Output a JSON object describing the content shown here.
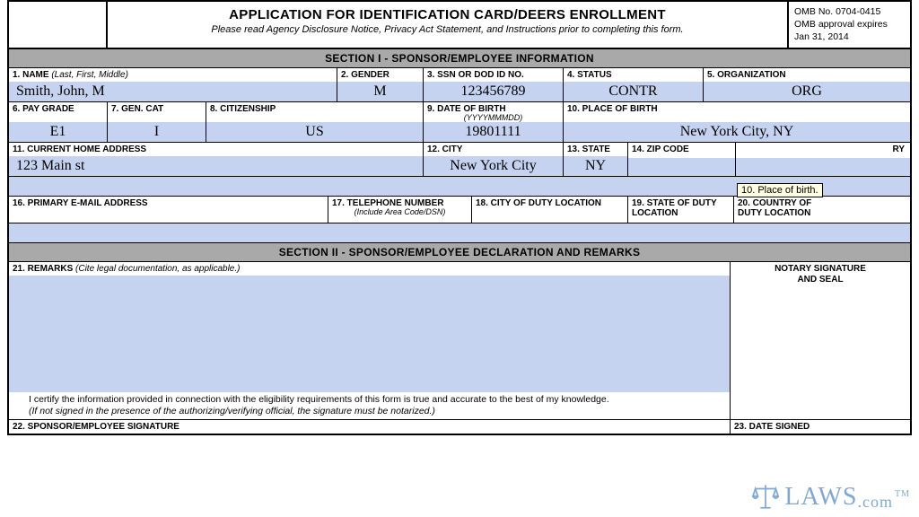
{
  "header": {
    "title": "APPLICATION FOR IDENTIFICATION CARD/DEERS ENROLLMENT",
    "subtitle": "Please read Agency Disclosure Notice, Privacy Act Statement, and Instructions prior to completing this form.",
    "omb_no": "OMB No. 0704-0415",
    "omb_exp": "OMB approval expires",
    "omb_date": "Jan 31, 2014"
  },
  "section1": {
    "title": "SECTION I - SPONSOR/EMPLOYEE INFORMATION",
    "f1": {
      "label": "1.  NAME",
      "paren": " (Last, First, Middle)",
      "value": "Smith, John, M"
    },
    "f2": {
      "label": "2.  GENDER",
      "value": "M"
    },
    "f3": {
      "label": "3.  SSN OR DOD ID NO.",
      "value": "123456789"
    },
    "f4": {
      "label": "4.  STATUS",
      "value": "CONTR"
    },
    "f5": {
      "label": "5.  ORGANIZATION",
      "value": "ORG"
    },
    "g6": {
      "label": "6.  PAY GRADE",
      "value": "E1"
    },
    "g7": {
      "label": "7.  GEN. CAT",
      "value": "I"
    },
    "g8": {
      "label": "8.  CITIZENSHIP",
      "value": "US"
    },
    "g9": {
      "label": "9.  DATE OF BIRTH",
      "sub": "(YYYYMMMDD)",
      "value": "19801111"
    },
    "g10": {
      "label": "10.  PLACE OF BIRTH",
      "value": "New York City, NY"
    },
    "h11": {
      "label": "11.  CURRENT HOME ADDRESS",
      "value": "123 Main st"
    },
    "h12": {
      "label": "12.  CITY",
      "value": "New York City"
    },
    "h13": {
      "label": "13.  STATE",
      "value": "NY"
    },
    "h14": {
      "label": "14.  ZIP CODE",
      "value": ""
    },
    "h15": {
      "label_suffix": "RY",
      "value": ""
    },
    "i16": {
      "label": "16.  PRIMARY E-MAIL ADDRESS"
    },
    "i17": {
      "label": "17.  TELEPHONE NUMBER",
      "sub": "(Include Area Code/DSN)"
    },
    "i18": {
      "label": "18.  CITY OF DUTY LOCATION"
    },
    "i19": {
      "label": "19.  STATE OF DUTY",
      "sub2": "LOCATION"
    },
    "i20": {
      "label": "20.  COUNTRY OF",
      "sub2": "DUTY LOCATION"
    }
  },
  "section2": {
    "title": "SECTION II - SPONSOR/EMPLOYEE DECLARATION AND REMARKS",
    "remarks_label": "21.  REMARKS",
    "remarks_paren": " (Cite legal documentation, as applicable.)",
    "notary_label1": "NOTARY SIGNATURE",
    "notary_label2": "AND SEAL",
    "cert_line1": "I certify the information provided in connection with the eligibility requirements of this form is true and accurate to the best of my knowledge.",
    "cert_line2": "(If not signed in the presence of the authorizing/verifying official, the signature must be notarized.)",
    "sig22": "22.  SPONSOR/EMPLOYEE SIGNATURE",
    "sig23": "23.  DATE SIGNED"
  },
  "tooltip": "10. Place of birth.",
  "watermark": "LAWS",
  "watermark_suffix": ".com"
}
